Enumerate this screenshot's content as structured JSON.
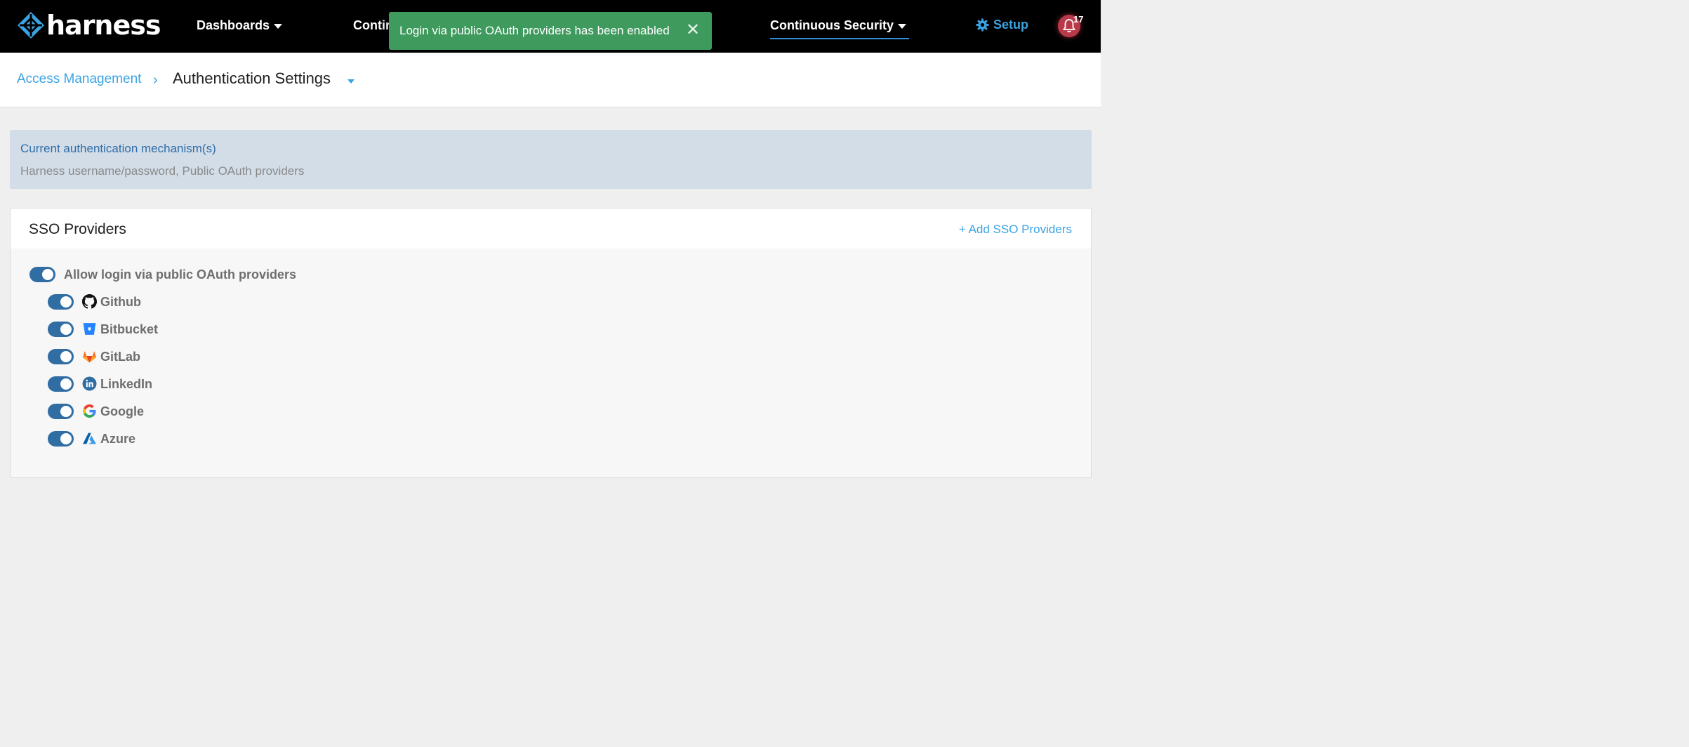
{
  "brand": {
    "name": "harness"
  },
  "nav": {
    "dashboards": "Dashboards",
    "continuous_truncated": "Contir",
    "continuous_security": "Continuous Security",
    "setup": "Setup",
    "notification_count": "17"
  },
  "toast": {
    "message": "Login via public OAuth providers has been enabled",
    "close": "✕"
  },
  "breadcrumb": {
    "parent": "Access Management",
    "separator": "›",
    "current": "Authentication Settings"
  },
  "auth_info": {
    "title": "Current authentication mechanism(s)",
    "value": "Harness username/password, Public OAuth providers"
  },
  "sso": {
    "title": "SSO Providers",
    "add_label": "+ Add SSO Providers",
    "master_toggle_label": "Allow login via public OAuth providers",
    "providers": [
      {
        "name": "Github",
        "icon": "github-icon",
        "enabled": true
      },
      {
        "name": "Bitbucket",
        "icon": "bitbucket-icon",
        "enabled": true
      },
      {
        "name": "GitLab",
        "icon": "gitlab-icon",
        "enabled": true
      },
      {
        "name": "LinkedIn",
        "icon": "linkedin-icon",
        "enabled": true
      },
      {
        "name": "Google",
        "icon": "google-icon",
        "enabled": true
      },
      {
        "name": "Azure",
        "icon": "azure-icon",
        "enabled": true
      }
    ]
  },
  "colors": {
    "nav_bg": "#000000",
    "accent": "#3aa3e3",
    "toast_bg": "#3f9a5e",
    "toggle_on": "#2f6da3",
    "info_bg": "#d3dde7"
  }
}
